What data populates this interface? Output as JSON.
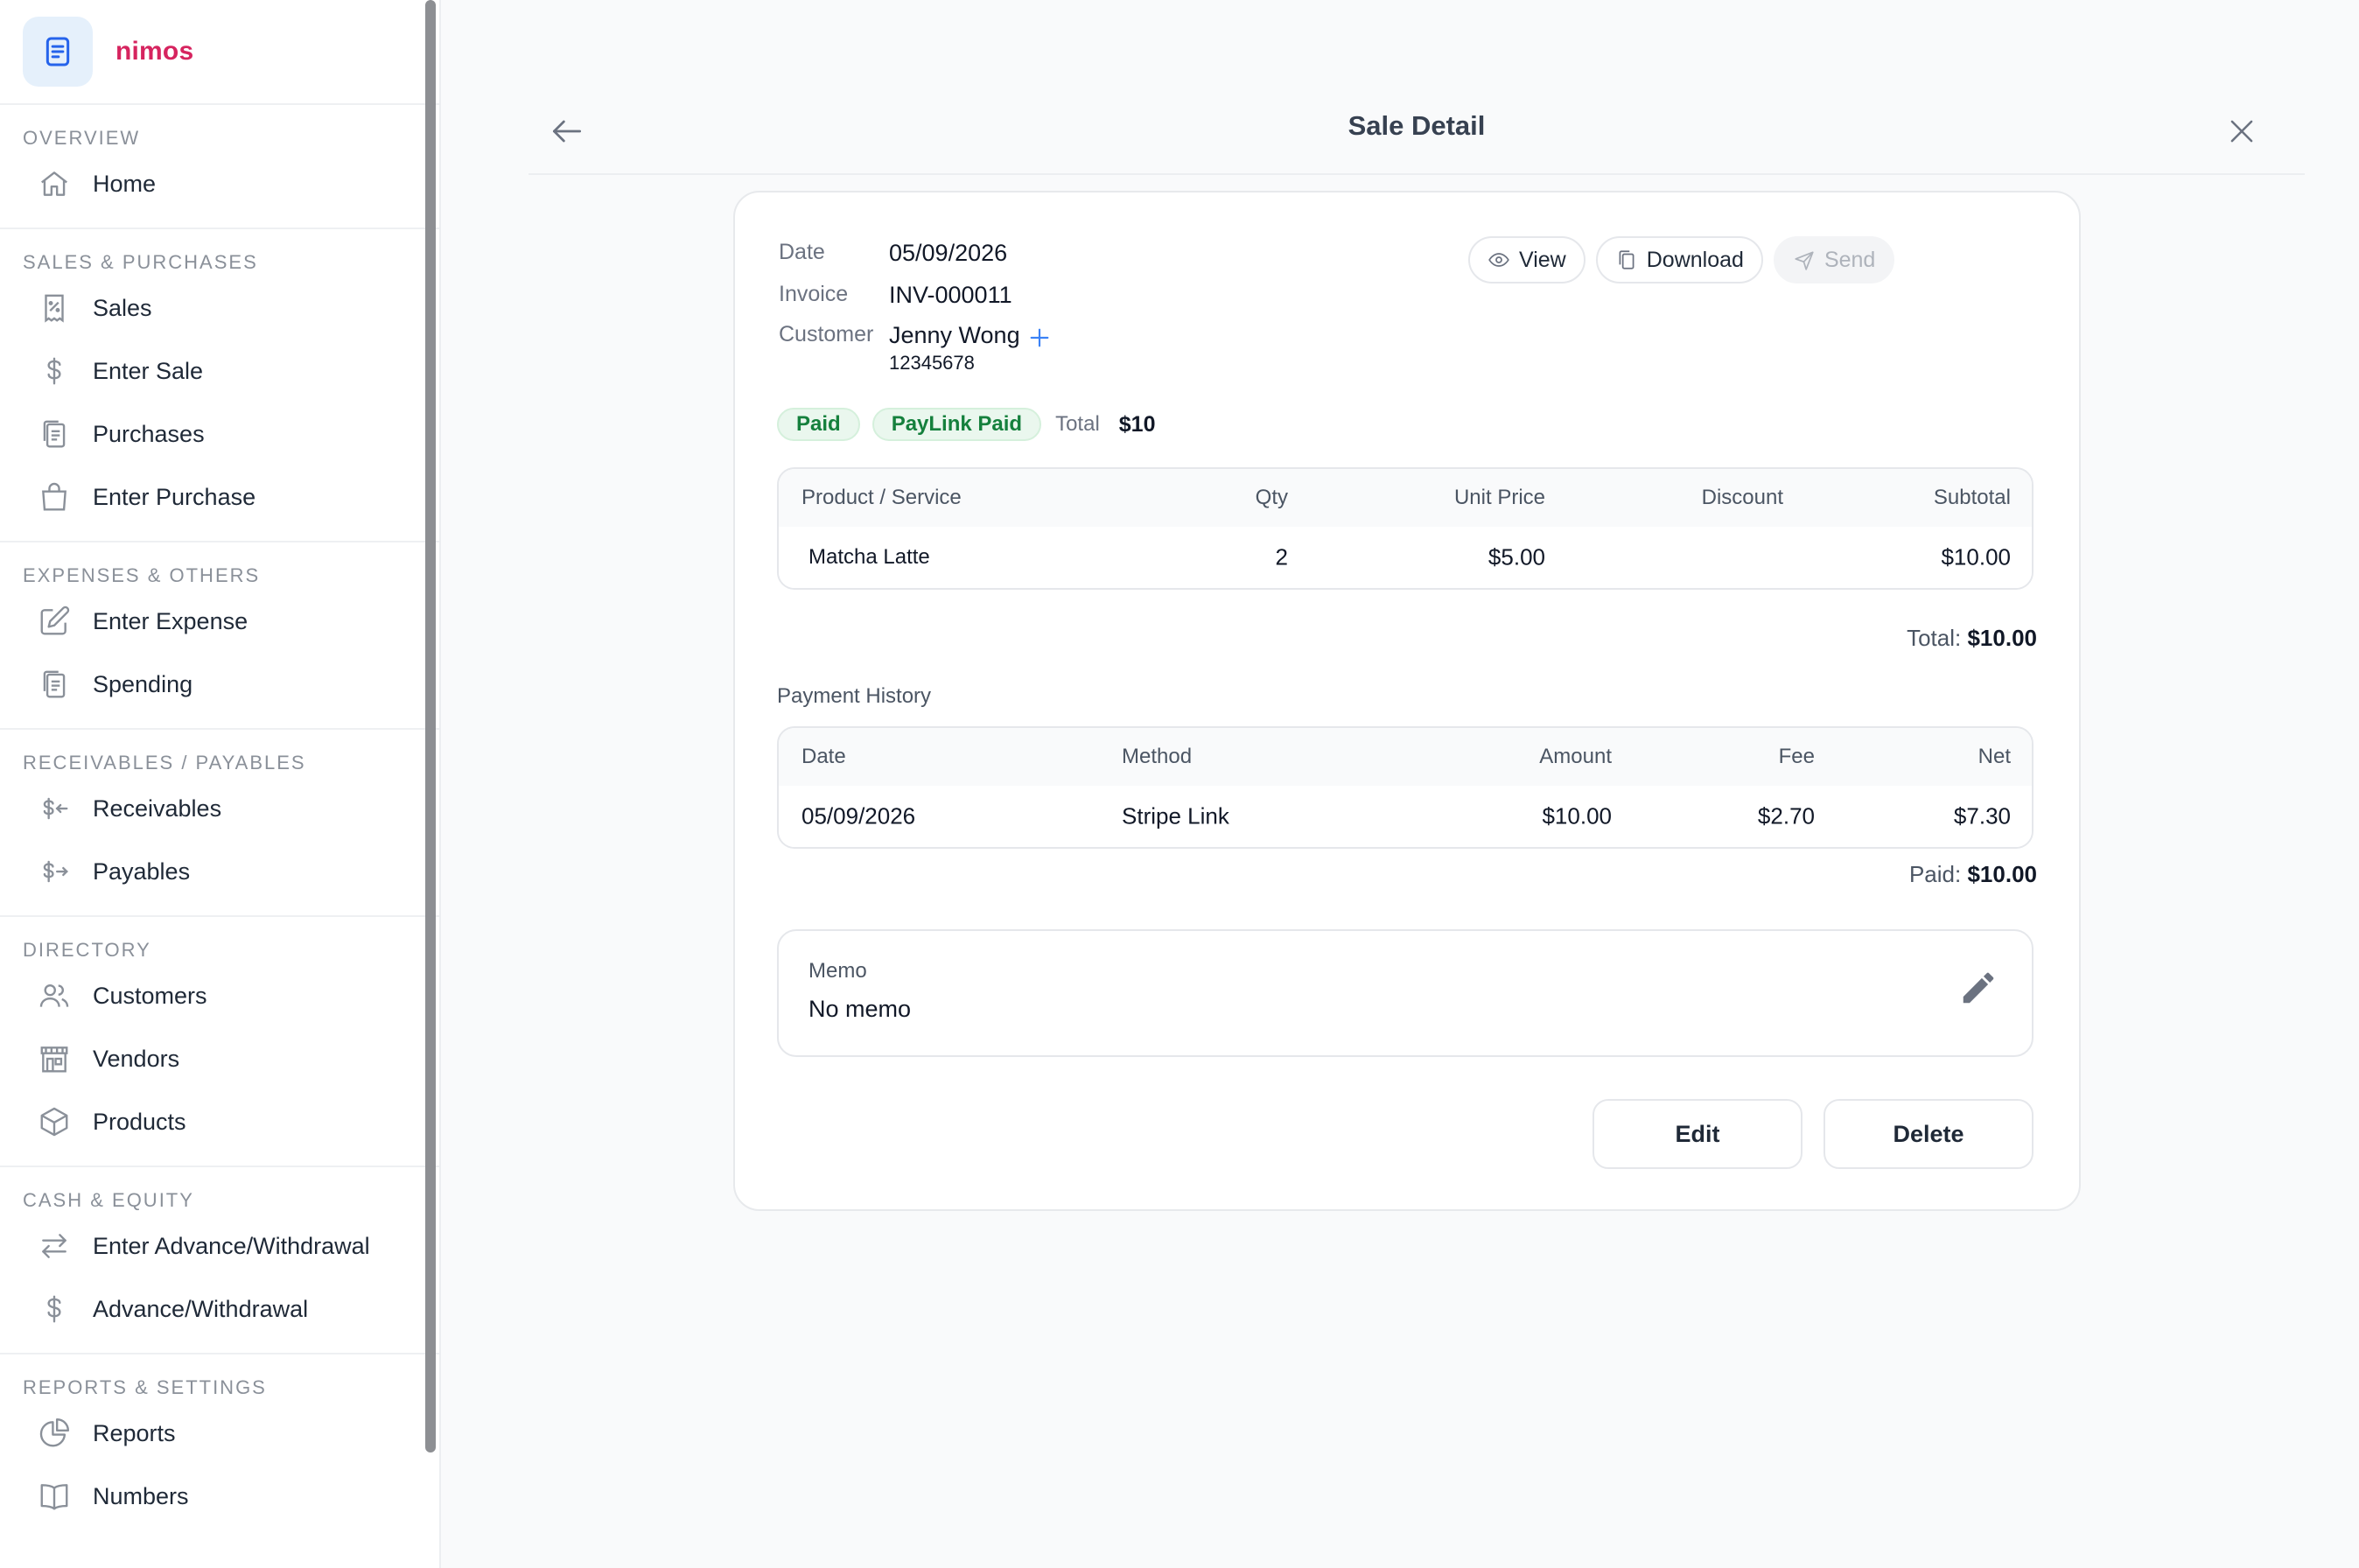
{
  "brand": {
    "name": "nimos"
  },
  "sidebar": {
    "sections": [
      {
        "title": "Overview",
        "items": [
          {
            "label": "Home",
            "icon": "home-icon"
          }
        ]
      },
      {
        "title": "Sales & Purchases",
        "items": [
          {
            "label": "Sales",
            "icon": "receipt-icon"
          },
          {
            "label": "Enter Sale",
            "icon": "dollar-icon"
          },
          {
            "label": "Purchases",
            "icon": "documents-icon"
          },
          {
            "label": "Enter Purchase",
            "icon": "shopping-bag-icon"
          }
        ]
      },
      {
        "title": "Expenses & Others",
        "items": [
          {
            "label": "Enter Expense",
            "icon": "pencil-square-icon"
          },
          {
            "label": "Spending",
            "icon": "documents-icon"
          }
        ]
      },
      {
        "title": "Receivables / Payables",
        "items": [
          {
            "label": "Receivables",
            "icon": "dollar-arrow-left-icon"
          },
          {
            "label": "Payables",
            "icon": "dollar-arrow-right-icon"
          }
        ]
      },
      {
        "title": "Directory",
        "items": [
          {
            "label": "Customers",
            "icon": "users-icon"
          },
          {
            "label": "Vendors",
            "icon": "storefront-icon"
          },
          {
            "label": "Products",
            "icon": "cube-icon"
          }
        ]
      },
      {
        "title": "Cash & Equity",
        "items": [
          {
            "label": "Enter Advance/Withdrawal",
            "icon": "arrows-exchange-icon"
          },
          {
            "label": "Advance/Withdrawal",
            "icon": "dollar-icon"
          }
        ]
      },
      {
        "title": "Reports & Settings",
        "items": [
          {
            "label": "Reports",
            "icon": "pie-chart-icon"
          },
          {
            "label": "Numbers",
            "icon": "book-icon"
          }
        ]
      }
    ]
  },
  "header": {
    "title": "Sale Detail"
  },
  "sale": {
    "date_label": "Date",
    "date": "05/09/2026",
    "invoice_label": "Invoice",
    "invoice": "INV-000011",
    "customer_label": "Customer",
    "customer_name": "Jenny Wong",
    "customer_phone": "12345678"
  },
  "actions": {
    "view": "View",
    "download": "Download",
    "send": "Send"
  },
  "badges": {
    "paid": "Paid",
    "paylink": "PayLink Paid",
    "total_label": "Total",
    "total_value": "$10"
  },
  "items_table": {
    "headers": [
      "Product / Service",
      "Qty",
      "Unit Price",
      "Discount",
      "Subtotal"
    ],
    "rows": [
      {
        "product": "Matcha Latte",
        "qty": "2",
        "unit_price": "$5.00",
        "discount": "",
        "subtotal": "$10.00"
      }
    ]
  },
  "totals": {
    "total_label": "Total:",
    "total_value": "$10.00"
  },
  "payment_history": {
    "title": "Payment History",
    "headers": [
      "Date",
      "Method",
      "Amount",
      "Fee",
      "Net"
    ],
    "rows": [
      {
        "date": "05/09/2026",
        "method": "Stripe Link",
        "amount": "$10.00",
        "fee": "$2.70",
        "net": "$7.30"
      }
    ],
    "paid_label": "Paid:",
    "paid_value": "$10.00"
  },
  "memo": {
    "label": "Memo",
    "value": "No memo"
  },
  "footer": {
    "edit": "Edit",
    "delete": "Delete"
  },
  "colors": {
    "brand": "#d6245f",
    "accent_blue": "#3b82f6",
    "paid_green": "#15803d"
  }
}
